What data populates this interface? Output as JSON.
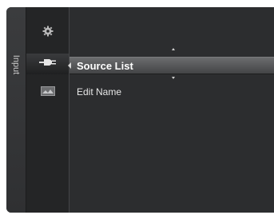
{
  "tab": {
    "label": "Input"
  },
  "icons": [
    {
      "name": "gear-icon",
      "active": false
    },
    {
      "name": "input-plug-icon",
      "active": true
    },
    {
      "name": "monitor-icon",
      "active": false
    }
  ],
  "menu": {
    "items": [
      {
        "label": "Source List",
        "selected": true
      },
      {
        "label": "Edit Name",
        "selected": false
      }
    ]
  },
  "colors": {
    "frame": "#2e2f31",
    "selected_highlight": "#5a5b5d",
    "text": "#e7e7e7"
  }
}
